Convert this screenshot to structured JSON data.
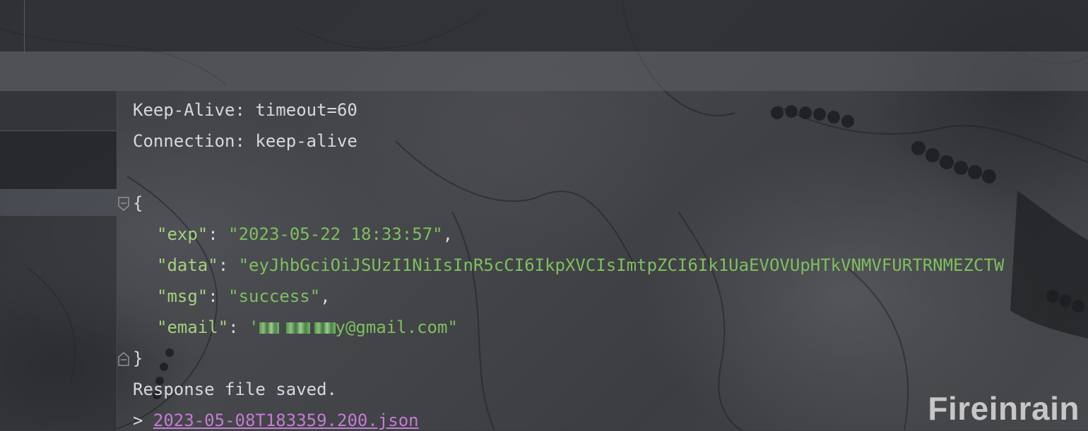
{
  "response": {
    "headers": [
      {
        "text": "Keep-Alive: timeout=60"
      },
      {
        "text": "Connection: keep-alive"
      }
    ],
    "json_open": "{",
    "json_close": "}",
    "fields": [
      {
        "key": "\"exp\"",
        "colon": ": ",
        "value": "\"2023-05-22 18:33:57\"",
        "trail": ","
      },
      {
        "key": "\"data\"",
        "colon": ": ",
        "value": "\"eyJhbGciOiJSUzI1NiIsInR5cCI6IkpXVCIsImtpZCI6Ik1UaEVOVUpHTkVNMVFURTRNMEZCTW",
        "trail": ""
      },
      {
        "key": "\"msg\"",
        "colon": ": ",
        "value": "\"success\"",
        "trail": ","
      }
    ],
    "email_field": {
      "key": "\"email\"",
      "colon": ": ",
      "value_prefix": "'",
      "value_suffix": "y@gmail.com\""
    },
    "saved_message": "Response file saved.",
    "saved_prompt": "> ",
    "saved_file": "2023-05-08T183359.200.json"
  },
  "watermark": "Fireinrain",
  "colors": {
    "key": "#a5d17d",
    "string": "#7fbf5f",
    "link": "#c57bd3",
    "text": "#d6d8dc"
  },
  "icons": {
    "fold_open": "fold-open-icon",
    "fold_close": "fold-close-icon"
  }
}
